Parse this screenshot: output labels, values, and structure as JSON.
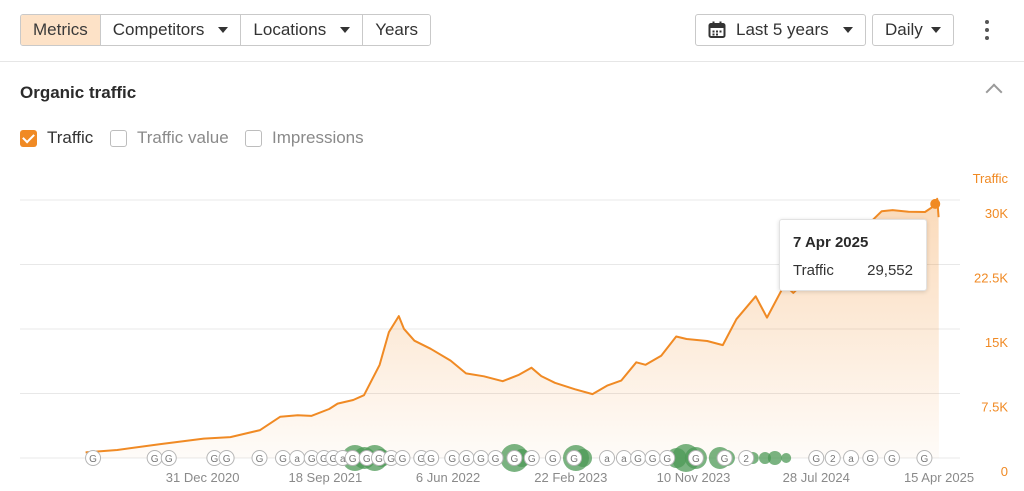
{
  "toolbar": {
    "tabs": [
      {
        "label": "Metrics",
        "active": true
      },
      {
        "label": "Competitors",
        "dropdown": true
      },
      {
        "label": "Locations",
        "dropdown": true
      },
      {
        "label": "Years"
      }
    ],
    "date_range": "Last 5 years",
    "interval": "Daily",
    "calendar_icon": "calendar-icon",
    "more_icon": "more-vertical-icon"
  },
  "section": {
    "title": "Organic traffic",
    "collapse_icon": "chevron-up-icon"
  },
  "metrics": [
    {
      "label": "Traffic",
      "checked": true
    },
    {
      "label": "Traffic value",
      "checked": false
    },
    {
      "label": "Impressions",
      "checked": false
    }
  ],
  "tooltip": {
    "date": "7 Apr 2025",
    "series": "Traffic",
    "value": "29,552"
  },
  "colors": {
    "accent": "#f08a24",
    "active_tab_bg": "#fde2c7",
    "marker_green": "#4e9a57"
  },
  "chart_data": {
    "type": "area",
    "ylabel": "Traffic",
    "ylim": [
      0,
      32000
    ],
    "yticks": [
      {
        "v": 0,
        "label": "0"
      },
      {
        "v": 7500,
        "label": "7.5K"
      },
      {
        "v": 15000,
        "label": "15K"
      },
      {
        "v": 22500,
        "label": "22.5K"
      },
      {
        "v": 30000,
        "label": "30K"
      }
    ],
    "x_start": "2020-04-27",
    "x_end": "2025-04-15",
    "xticks": [
      {
        "date": "2020-12-31",
        "label": "31 Dec 2020"
      },
      {
        "date": "2021-09-18",
        "label": "18 Sep 2021"
      },
      {
        "date": "2022-06-06",
        "label": "6 Jun 2022"
      },
      {
        "date": "2023-02-22",
        "label": "22 Feb 2023"
      },
      {
        "date": "2023-11-10",
        "label": "10 Nov 2023"
      },
      {
        "date": "2024-07-28",
        "label": "28 Jul 2024"
      },
      {
        "date": "2025-04-15",
        "label": "15 Apr 2025"
      }
    ],
    "series": [
      {
        "name": "Traffic",
        "color": "#f08a24",
        "points": [
          [
            "2020-04-27",
            650
          ],
          [
            "2020-07-01",
            1100
          ],
          [
            "2020-10-01",
            1450
          ],
          [
            "2021-01-01",
            2250
          ],
          [
            "2021-03-01",
            2600
          ],
          [
            "2021-05-01",
            3100
          ],
          [
            "2021-06-15",
            4800
          ],
          [
            "2021-07-20",
            5150
          ],
          [
            "2021-08-20",
            4750
          ],
          [
            "2021-09-25",
            5700
          ],
          [
            "2021-10-15",
            6500
          ],
          [
            "2021-11-15",
            6600
          ],
          [
            "2021-12-10",
            7300
          ],
          [
            "2022-01-10",
            11000
          ],
          [
            "2022-02-01",
            14500
          ],
          [
            "2022-02-20",
            16500
          ],
          [
            "2022-03-05",
            15200
          ],
          [
            "2022-03-25",
            13500
          ],
          [
            "2022-05-01",
            12700
          ],
          [
            "2022-06-10",
            11500
          ],
          [
            "2022-07-15",
            9700
          ],
          [
            "2022-08-20",
            9500
          ],
          [
            "2022-10-01",
            9100
          ],
          [
            "2022-11-01",
            9500
          ],
          [
            "2022-12-01",
            10500
          ],
          [
            "2022-12-20",
            9700
          ],
          [
            "2023-01-20",
            8600
          ],
          [
            "2023-03-01",
            8000
          ],
          [
            "2023-04-10",
            7600
          ],
          [
            "2023-05-10",
            8300
          ],
          [
            "2023-06-10",
            9000
          ],
          [
            "2023-07-10",
            11300
          ],
          [
            "2023-08-01",
            10700
          ],
          [
            "2023-09-01",
            11900
          ],
          [
            "2023-10-05",
            14300
          ],
          [
            "2023-10-25",
            13700
          ],
          [
            "2023-12-10",
            13600
          ],
          [
            "2024-01-10",
            13300
          ],
          [
            "2024-02-10",
            16000
          ],
          [
            "2024-03-20",
            18800
          ],
          [
            "2024-04-15",
            16500
          ],
          [
            "2024-05-20",
            20000
          ],
          [
            "2024-06-10",
            19200
          ],
          [
            "2024-07-01",
            20600
          ],
          [
            "2024-08-01",
            21600
          ],
          [
            "2024-09-10",
            23500
          ],
          [
            "2024-10-10",
            25000
          ],
          [
            "2024-11-10",
            26800
          ],
          [
            "2024-12-15",
            28700
          ],
          [
            "2025-01-05",
            29000
          ],
          [
            "2025-02-10",
            28500
          ],
          [
            "2025-03-15",
            28600
          ],
          [
            "2025-04-07",
            29552
          ],
          [
            "2025-04-10",
            30000
          ],
          [
            "2025-04-15",
            28000
          ]
        ]
      }
    ],
    "annotations": [
      {
        "date": "2020-05-12",
        "label": "G"
      },
      {
        "date": "2020-09-20",
        "label": "G"
      },
      {
        "date": "2020-10-20",
        "label": "G"
      },
      {
        "date": "2021-01-25",
        "label": "G"
      },
      {
        "date": "2021-02-20",
        "label": "G"
      },
      {
        "date": "2021-05-01",
        "label": "G"
      },
      {
        "date": "2021-06-20",
        "label": "G"
      },
      {
        "date": "2021-07-20",
        "label": "a"
      },
      {
        "date": "2021-08-20",
        "label": "G"
      },
      {
        "date": "2021-09-15",
        "label": "G"
      },
      {
        "date": "2021-10-05",
        "label": "G"
      },
      {
        "date": "2021-10-25",
        "label": "a"
      },
      {
        "date": "2021-11-15",
        "label": "G"
      },
      {
        "date": "2021-12-15",
        "label": "G"
      },
      {
        "date": "2022-01-10",
        "label": "G"
      },
      {
        "date": "2022-02-05",
        "label": "G"
      },
      {
        "date": "2022-03-01",
        "label": "G"
      },
      {
        "date": "2022-04-10",
        "label": "G"
      },
      {
        "date": "2022-05-01",
        "label": "G"
      },
      {
        "date": "2022-06-15",
        "label": "G"
      },
      {
        "date": "2022-07-15",
        "label": "G"
      },
      {
        "date": "2022-08-15",
        "label": "G"
      },
      {
        "date": "2022-09-15",
        "label": "G"
      },
      {
        "date": "2022-10-25",
        "label": "G"
      },
      {
        "date": "2022-12-01",
        "label": "G"
      },
      {
        "date": "2023-01-15",
        "label": "G"
      },
      {
        "date": "2023-03-01",
        "label": "G"
      },
      {
        "date": "2023-05-10",
        "label": "a"
      },
      {
        "date": "2023-06-15",
        "label": "a"
      },
      {
        "date": "2023-07-15",
        "label": "G"
      },
      {
        "date": "2023-08-15",
        "label": "G"
      },
      {
        "date": "2023-09-15",
        "label": "G"
      },
      {
        "date": "2023-11-15",
        "label": "G"
      },
      {
        "date": "2024-01-15",
        "label": "G"
      },
      {
        "date": "2024-03-01",
        "label": "2"
      },
      {
        "date": "2024-07-28",
        "label": "G"
      },
      {
        "date": "2024-09-01",
        "label": "2"
      },
      {
        "date": "2024-10-10",
        "label": "a"
      },
      {
        "date": "2024-11-20",
        "label": "G"
      },
      {
        "date": "2025-01-05",
        "label": "G"
      },
      {
        "date": "2025-03-15",
        "label": "G"
      }
    ],
    "green_markers": [
      {
        "date": "2021-11-20",
        "r": 13
      },
      {
        "date": "2021-12-10",
        "r": 11
      },
      {
        "date": "2022-01-01",
        "r": 13
      },
      {
        "date": "2022-01-15",
        "r": 9
      },
      {
        "date": "2022-10-25",
        "r": 14
      },
      {
        "date": "2022-11-10",
        "r": 9
      },
      {
        "date": "2023-03-05",
        "r": 13
      },
      {
        "date": "2023-03-20",
        "r": 9
      },
      {
        "date": "2023-10-05",
        "r": 10
      },
      {
        "date": "2023-10-25",
        "r": 14
      },
      {
        "date": "2023-11-15",
        "r": 11
      },
      {
        "date": "2024-01-05",
        "r": 11
      },
      {
        "date": "2024-01-20",
        "r": 8
      },
      {
        "date": "2024-03-15",
        "r": 6
      },
      {
        "date": "2024-04-10",
        "r": 6
      },
      {
        "date": "2024-05-01",
        "r": 7
      },
      {
        "date": "2024-05-25",
        "r": 5
      }
    ],
    "highlight_point": {
      "date": "2025-04-07",
      "value": 29552
    }
  }
}
